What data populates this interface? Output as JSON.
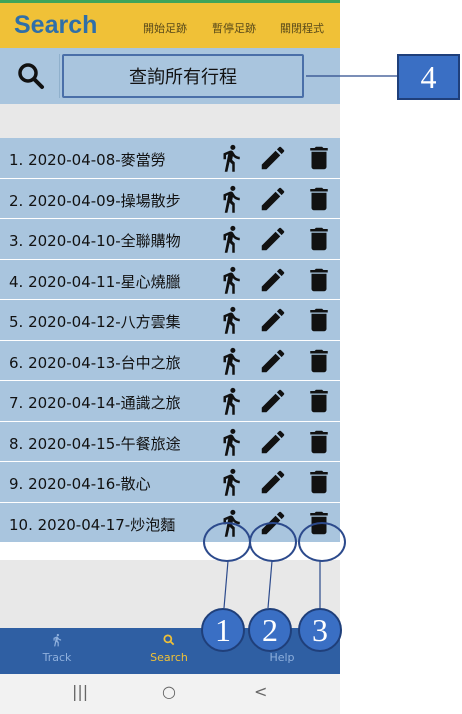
{
  "header": {
    "title": "Search",
    "menu": [
      "開始足跡",
      "暫停足跡",
      "關閉程式"
    ]
  },
  "search": {
    "icon": "search-icon",
    "query_button": "查詢所有行程"
  },
  "trips": [
    "1. 2020-04-08-麥當勞",
    "2. 2020-04-09-操場散步",
    "3. 2020-04-10-全聯購物",
    "4. 2020-04-11-星心燒臘",
    "5. 2020-04-12-八方雲集",
    "6. 2020-04-13-台中之旅",
    "7. 2020-04-14-通識之旅",
    "8. 2020-04-15-午餐旅途",
    "9. 2020-04-16-散心",
    "10. 2020-04-17-炒泡麵"
  ],
  "row_icons": [
    "run-icon",
    "edit-pencil-icon",
    "trash-icon"
  ],
  "bottom_nav": [
    {
      "label": "Track",
      "icon": "run-icon"
    },
    {
      "label": "Search",
      "icon": "search-icon"
    },
    {
      "label": "Help",
      "icon": "help-icon"
    }
  ],
  "system_nav": [
    "|||",
    "○",
    "<"
  ],
  "annotations": [
    "1",
    "2",
    "3",
    "4"
  ],
  "colors": {
    "header": "#f0c137",
    "title": "#2f6fa8",
    "row": "#a9c5de",
    "nav": "#2f5fa3",
    "badge": "#3a6fc4"
  }
}
